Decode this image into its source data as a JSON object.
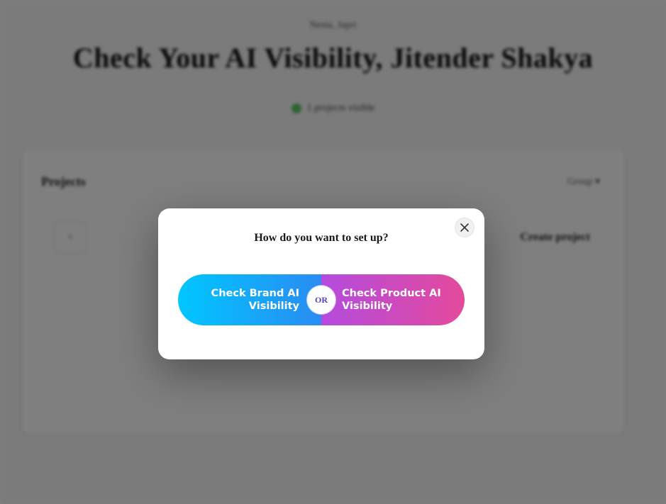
{
  "background": {
    "breadcrumb": "Nesta, Japri",
    "hero_title": "Check Your AI Visibility, Jitender Shakya",
    "status_text": "1 projects visible",
    "projects_title": "Projects",
    "sort_label": "Group ▾",
    "create_label": "Create project",
    "row_icon": "+"
  },
  "modal": {
    "title": "How do you want to set up?",
    "close_icon": "close-icon",
    "brand_label": "Check Brand AI Visibility",
    "or_label": "OR",
    "product_label": "Check Product AI Visibility"
  },
  "colors": {
    "brand_gradient_start": "#00c6ff",
    "brand_gradient_end": "#2a8cf2",
    "product_gradient_start": "#b44bde",
    "product_gradient_end": "#e44a9c",
    "or_text": "#5a3fb8"
  }
}
